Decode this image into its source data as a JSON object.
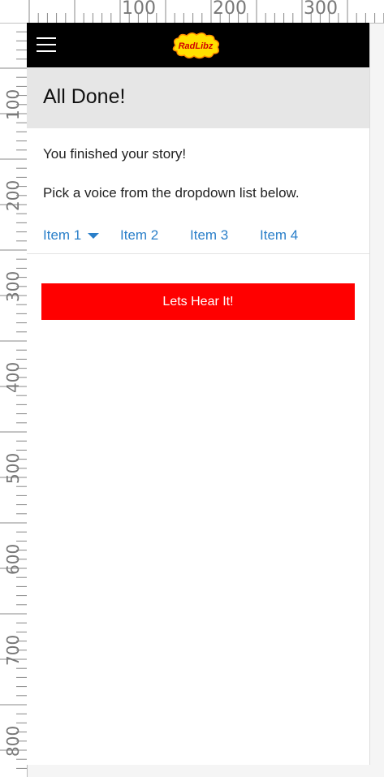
{
  "ruler": {
    "top_labels": [
      "100",
      "200",
      "300"
    ],
    "left_labels": [
      "100",
      "200",
      "300",
      "400",
      "500",
      "600",
      "700",
      "800"
    ]
  },
  "topbar": {
    "menu_icon": "hamburger-icon",
    "logo_text": "RadLibz",
    "background": "#000000"
  },
  "header": {
    "title": "All Done!"
  },
  "content": {
    "line1": "You finished your story!",
    "line2": "Pick a voice from the dropdown list below."
  },
  "tabs": [
    {
      "label": "Item 1",
      "has_dropdown": true
    },
    {
      "label": "Item 2"
    },
    {
      "label": "Item 3"
    },
    {
      "label": "Item 4"
    }
  ],
  "action": {
    "button_label": "Lets Hear It!",
    "color": "#ff0000"
  },
  "colors": {
    "link": "#2a7fc9",
    "header_bg": "#e6e6e6"
  }
}
